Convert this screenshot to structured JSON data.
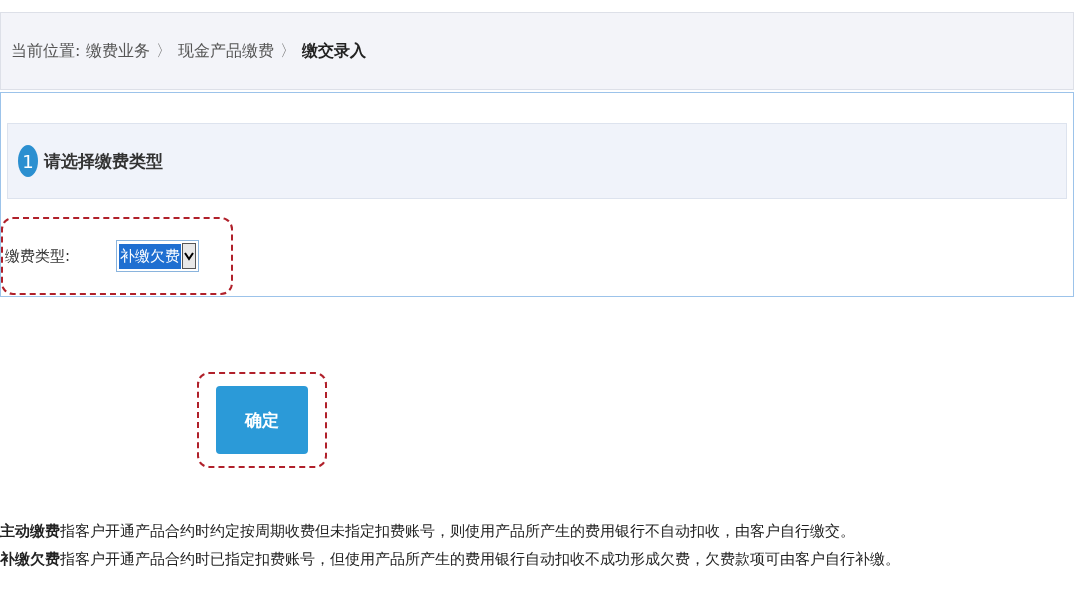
{
  "breadcrumb": {
    "label": "当前位置:",
    "items": [
      {
        "text": "缴费业务",
        "current": false
      },
      {
        "text": "现金产品缴费",
        "current": false
      },
      {
        "text": "缴交录入",
        "current": true
      }
    ],
    "separator": "〉"
  },
  "step": {
    "number": "1",
    "title": "请选择缴费类型"
  },
  "field": {
    "label": "缴费类型:",
    "value": "补缴欠费"
  },
  "confirm_button": "确定",
  "notes": [
    "**主动缴费**指客户开通产品合约时约定按周期收费但未指定扣费账号，则使用产品所产生的费用银行不自动扣收，由客户自行缴交。",
    "**补缴欠费**指客户开通产品合约时已指定扣费账号，但使用产品所产生的费用银行自动扣收不成功形成欠费，欠费款项可由客户自行补缴。"
  ]
}
